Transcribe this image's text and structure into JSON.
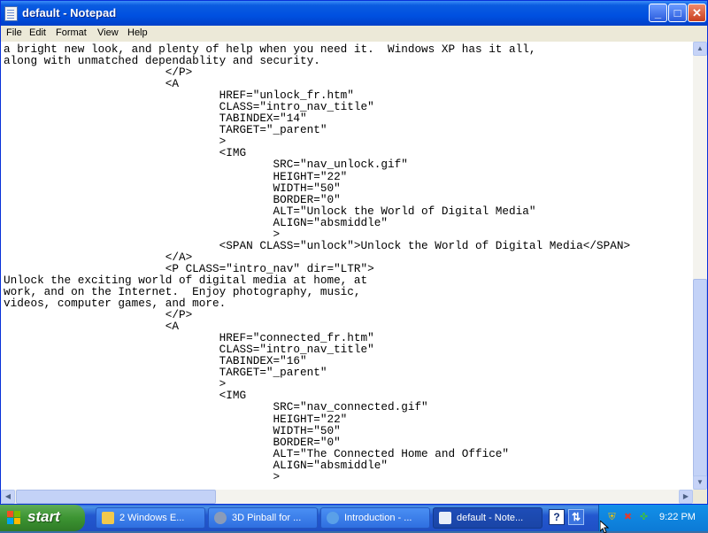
{
  "window": {
    "title": "default - Notepad",
    "controls": {
      "minimize": "_",
      "maximize": "□",
      "close": "✕"
    }
  },
  "menu": [
    "File",
    "Edit",
    "Format",
    "View",
    "Help"
  ],
  "editor": {
    "lines": [
      "a bright new look, and plenty of help when you need it.  Windows XP has it all,",
      "along with unmatched dependablity and security.",
      "                        </P>",
      "                        <A",
      "                                HREF=\"unlock_fr.htm\"",
      "                                CLASS=\"intro_nav_title\"",
      "                                TABINDEX=\"14\"",
      "                                TARGET=\"_parent\"",
      "                                >",
      "                                <IMG",
      "                                        SRC=\"nav_unlock.gif\"",
      "                                        HEIGHT=\"22\"",
      "                                        WIDTH=\"50\"",
      "                                        BORDER=\"0\"",
      "                                        ALT=\"Unlock the World of Digital Media\"",
      "                                        ALIGN=\"absmiddle\"",
      "                                        >",
      "                                <SPAN CLASS=\"unlock\">Unlock the World of Digital Media</SPAN>",
      "                        </A>",
      "                        <P CLASS=\"intro_nav\" dir=\"LTR\">",
      "Unlock the exciting world of digital media at home, at",
      "work, and on the Internet.  Enjoy photography, music,",
      "videos, computer games, and more.",
      "                        </P>",
      "                        <A",
      "                                HREF=\"connected_fr.htm\"",
      "                                CLASS=\"intro_nav_title\"",
      "                                TABINDEX=\"16\"",
      "                                TARGET=\"_parent\"",
      "                                >",
      "                                <IMG",
      "                                        SRC=\"nav_connected.gif\"",
      "                                        HEIGHT=\"22\"",
      "                                        WIDTH=\"50\"",
      "                                        BORDER=\"0\"",
      "                                        ALT=\"The Connected Home and Office\"",
      "                                        ALIGN=\"absmiddle\"",
      "                                        >"
    ]
  },
  "taskbar": {
    "start_label": "start",
    "tasks": [
      {
        "label": "2 Windows E...",
        "icon": "folder-icon",
        "active": false
      },
      {
        "label": "3D Pinball for ...",
        "icon": "pinball-icon",
        "active": false
      },
      {
        "label": "Introduction - ...",
        "icon": "internet-explorer-icon",
        "active": false
      },
      {
        "label": "default - Note...",
        "icon": "notepad-icon",
        "active": true
      }
    ],
    "quick_help_glyph": "?",
    "clock": "9:22 PM"
  },
  "colors": {
    "titlebar": "#0050e0",
    "taskbar": "#245edb",
    "start_button": "#3c9432",
    "tray": "#0f86e0"
  }
}
